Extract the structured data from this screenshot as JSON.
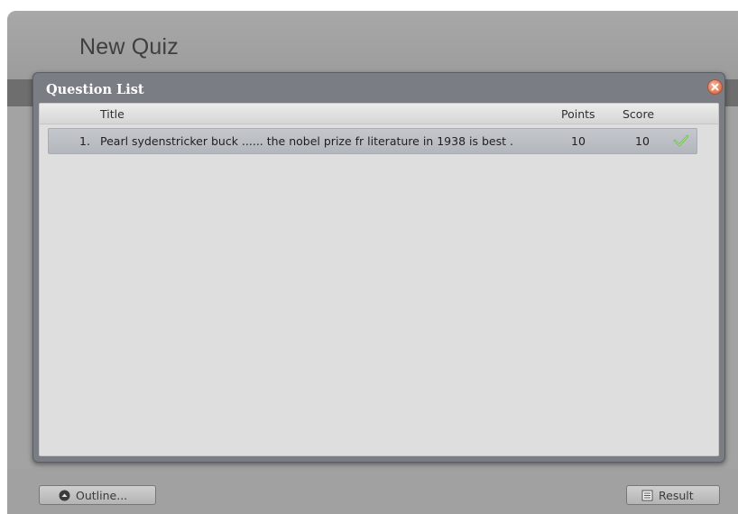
{
  "quiz": {
    "title": "New Quiz"
  },
  "modal": {
    "title": "Question List",
    "columns": {
      "title": "Title",
      "points": "Points",
      "score": "Score"
    },
    "rows": [
      {
        "number": "1.",
        "title": "Pearl sydenstricker buck ...... the nobel prize fr literature in 1938 is best .",
        "points": "10",
        "score": "10",
        "status_icon": "checkmark-icon"
      }
    ]
  },
  "footer": {
    "outline_label": "Outline...",
    "result_label": "Result"
  },
  "colors": {
    "modal_header": "#7a7d83",
    "row_highlight": "#b9bcc2",
    "check_green": "#6cc04a",
    "close_orange": "#e07d5c"
  }
}
